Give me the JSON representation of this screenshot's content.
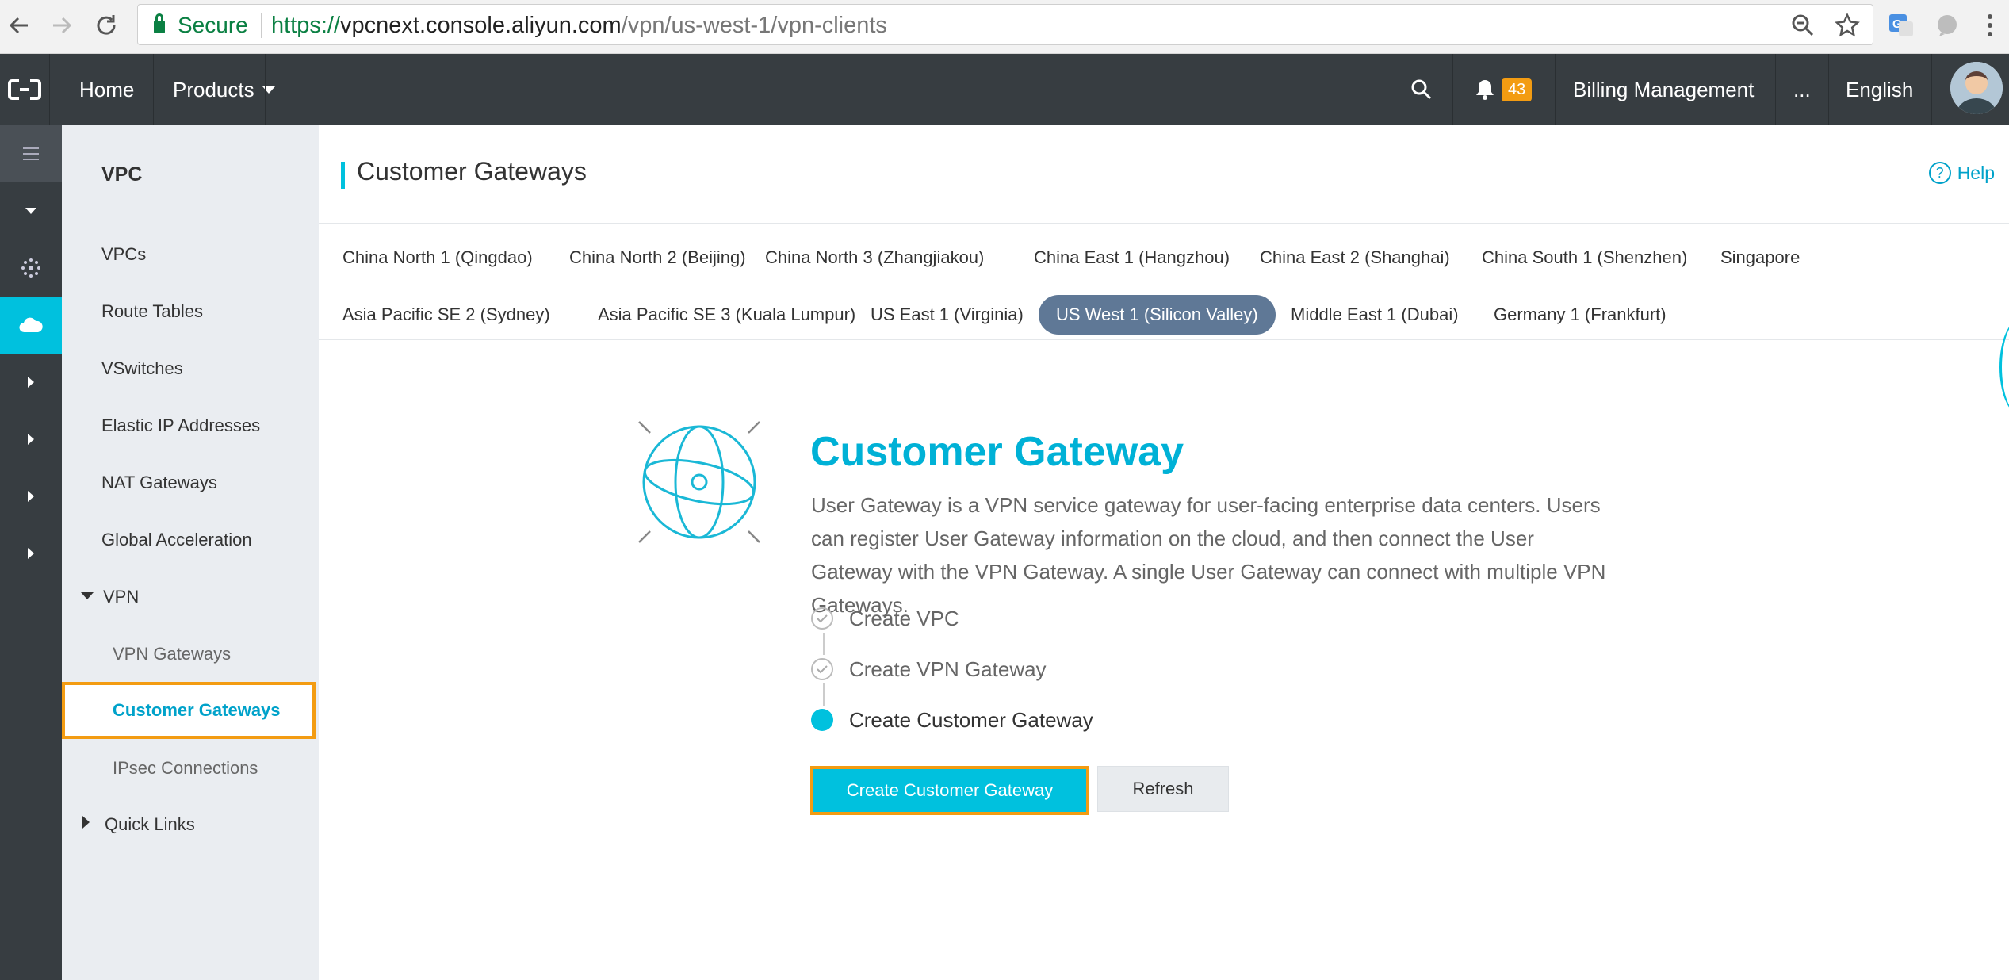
{
  "browser": {
    "secure_label": "Secure",
    "url_scheme": "https://",
    "url_host": "vpcnext.console.aliyun.com",
    "url_path": "/vpn/us-west-1/vpn-clients"
  },
  "topnav": {
    "home": "Home",
    "products": "Products",
    "notification_count": "43",
    "billing": "Billing Management",
    "more": "...",
    "language": "English"
  },
  "sidebar": {
    "title": "VPC",
    "items": [
      "VPCs",
      "Route Tables",
      "VSwitches",
      "Elastic IP Addresses",
      "NAT Gateways",
      "Global Acceleration"
    ],
    "vpn_group": "VPN",
    "vpn_items": [
      "VPN Gateways",
      "Customer Gateways",
      "IPsec Connections"
    ],
    "quick_links": "Quick Links"
  },
  "page": {
    "title": "Customer Gateways",
    "help": "Help"
  },
  "regions": {
    "row1": [
      "China North 1 (Qingdao)",
      "China North 2 (Beijing)",
      "China North 3 (Zhangjiakou)",
      "China East 1 (Hangzhou)",
      "China East 2 (Shanghai)",
      "China South 1 (Shenzhen)",
      "Singapore"
    ],
    "row2": [
      "Asia Pacific SE 2 (Sydney)",
      "Asia Pacific SE 3 (Kuala Lumpur)",
      "US East 1 (Virginia)",
      "US West 1 (Silicon Valley)",
      "Middle East 1 (Dubai)",
      "Germany 1 (Frankfurt)"
    ],
    "selected": "US West 1 (Silicon Valley)"
  },
  "hero": {
    "title": "Customer Gateway",
    "description": "User Gateway is a VPN service gateway for user-facing enterprise data centers. Users can register User Gateway information on the cloud, and then connect the User Gateway with the VPN Gateway. A single User Gateway can connect with multiple VPN Gateways.",
    "steps": [
      "Create VPC",
      "Create VPN Gateway",
      "Create Customer Gateway"
    ],
    "primary_button": "Create Customer Gateway",
    "secondary_button": "Refresh"
  },
  "colors": {
    "accent": "#00c1de",
    "highlight": "#f39c12",
    "topbar": "#373d41",
    "selected_region": "#5f7896"
  }
}
